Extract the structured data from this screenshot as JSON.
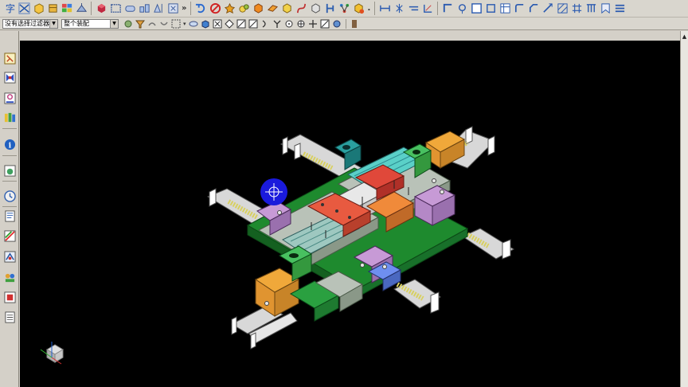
{
  "toolbar2": {
    "filter_value": "没有选择过滤器",
    "scope_value": "整个装配"
  },
  "icons": {
    "toolbar1": [
      "text-icon",
      "sketch-icon",
      "box-icon",
      "cylinder-icon",
      "layer-grid-icon",
      "plane-icon",
      "cube-color-icon",
      "rectangle-icon",
      "fillet-icon",
      "pattern-icon",
      "mirror-icon",
      "rotate-icon",
      "no-icon",
      "point-icon",
      "sphere-icon",
      "solid-orange-icon",
      "shell-icon",
      "revolve-icon",
      "curve-icon",
      "block-icon",
      "link-icon",
      "assembly-icon",
      "part-icon",
      "measure-icon",
      "dimension-icon",
      "trim-icon",
      "draft-icon",
      "angle-icon",
      "circle-icon",
      "square-icon",
      "table-icon",
      "corner-icon",
      "chamfer-icon",
      "hatch-icon",
      "grid-icon",
      "column-icon",
      "bookmark-icon",
      "menu-icon"
    ],
    "toolbar2": [
      "snap-icon",
      "filter-icon",
      "undo-icon",
      "redo-icon",
      "select-box-icon",
      "view-icon",
      "shade-icon",
      "endpoint-icon",
      "midpoint-icon",
      "line-icon",
      "arc-icon",
      "tangent-icon",
      "intersection-icon",
      "center-icon",
      "cross-icon",
      "quadrant-icon",
      "globe-icon",
      "clip-icon"
    ],
    "leftbar": [
      "assembly-navigator-icon",
      "constraint-navigator-icon",
      "part-navigator-icon",
      "reuse-library-icon",
      "info-icon",
      "web-browser-icon",
      "history-icon",
      "process-studio-icon",
      "palette-icon",
      "roles-icon",
      "system-scene-icon",
      "system-material-icon"
    ]
  },
  "colors": {
    "viewport_bg": "#000000",
    "cursor_marker": "#1a1adc",
    "frame_green": "#1e8a2e",
    "plate_gray": "#b9c2b8",
    "part_orange": "#f0a83a",
    "part_red": "#e0483a",
    "part_purple": "#c79ad6",
    "part_blue": "#6e8ff0",
    "spring_yellow": "#d8d060",
    "slide_white": "#e8e8e8",
    "core_teal": "#5ad0c8"
  }
}
